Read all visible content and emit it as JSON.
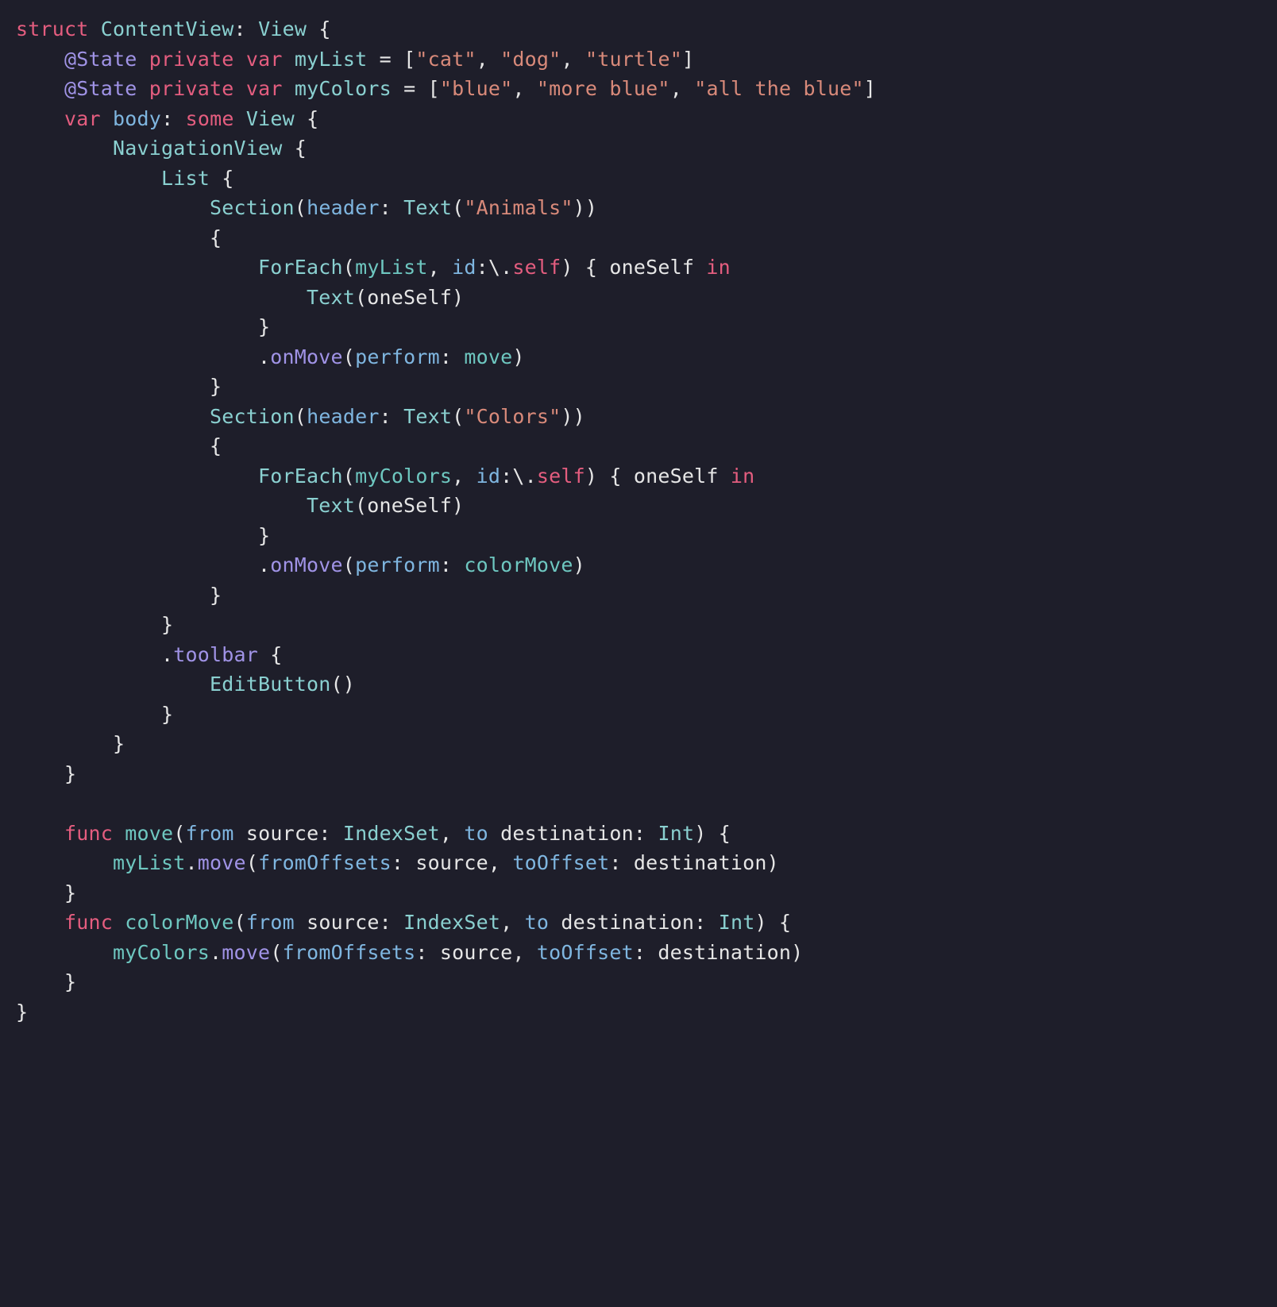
{
  "code": {
    "tokens": [
      [
        [
          "struct",
          "kw"
        ],
        [
          " ",
          ""
        ],
        [
          "ContentView",
          "type"
        ],
        [
          ": ",
          ""
        ],
        [
          "View",
          "type"
        ],
        [
          " {",
          ""
        ]
      ],
      [
        [
          "    ",
          ""
        ],
        [
          "@State",
          "prop"
        ],
        [
          " ",
          ""
        ],
        [
          "private",
          "kw"
        ],
        [
          " ",
          ""
        ],
        [
          "var",
          "kw"
        ],
        [
          " ",
          ""
        ],
        [
          "myList",
          "type"
        ],
        [
          " = [",
          ""
        ],
        [
          "\"cat\"",
          "str"
        ],
        [
          ", ",
          ""
        ],
        [
          "\"dog\"",
          "str"
        ],
        [
          ", ",
          ""
        ],
        [
          "\"turtle\"",
          "str"
        ],
        [
          "]",
          ""
        ]
      ],
      [
        [
          "    ",
          ""
        ],
        [
          "@State",
          "prop"
        ],
        [
          " ",
          ""
        ],
        [
          "private",
          "kw"
        ],
        [
          " ",
          ""
        ],
        [
          "var",
          "kw"
        ],
        [
          " ",
          ""
        ],
        [
          "myColors",
          "type"
        ],
        [
          " = [",
          ""
        ],
        [
          "\"blue\"",
          "str"
        ],
        [
          ", ",
          ""
        ],
        [
          "\"more blue\"",
          "str"
        ],
        [
          ", ",
          ""
        ],
        [
          "\"all the blue\"",
          "str"
        ],
        [
          "]",
          ""
        ]
      ],
      [
        [
          "    ",
          ""
        ],
        [
          "var",
          "kw"
        ],
        [
          " ",
          ""
        ],
        [
          "body",
          "param"
        ],
        [
          ": ",
          ""
        ],
        [
          "some",
          "kw"
        ],
        [
          " ",
          ""
        ],
        [
          "View",
          "type"
        ],
        [
          " {",
          ""
        ]
      ],
      [
        [
          "        ",
          ""
        ],
        [
          "NavigationView",
          "type"
        ],
        [
          " {",
          ""
        ]
      ],
      [
        [
          "            ",
          ""
        ],
        [
          "List",
          "type"
        ],
        [
          " {",
          ""
        ]
      ],
      [
        [
          "                ",
          ""
        ],
        [
          "Section",
          "type"
        ],
        [
          "(",
          ""
        ],
        [
          "header",
          "param"
        ],
        [
          ": ",
          ""
        ],
        [
          "Text",
          "type"
        ],
        [
          "(",
          ""
        ],
        [
          "\"Animals\"",
          "str"
        ],
        [
          "))",
          ""
        ]
      ],
      [
        [
          "                {",
          ""
        ]
      ],
      [
        [
          "                    ",
          ""
        ],
        [
          "ForEach",
          "type"
        ],
        [
          "(",
          ""
        ],
        [
          "myList",
          "teal"
        ],
        [
          ", ",
          ""
        ],
        [
          "id",
          "param"
        ],
        [
          ":\\.",
          ""
        ],
        [
          "self",
          "kw"
        ],
        [
          ") { oneSelf ",
          ""
        ],
        [
          "in",
          "kw"
        ]
      ],
      [
        [
          "                        ",
          ""
        ],
        [
          "Text",
          "type"
        ],
        [
          "(oneSelf)",
          ""
        ]
      ],
      [
        [
          "                    }",
          ""
        ]
      ],
      [
        [
          "                    .",
          ""
        ],
        [
          "onMove",
          "call"
        ],
        [
          "(",
          ""
        ],
        [
          "perform",
          "param"
        ],
        [
          ": ",
          ""
        ],
        [
          "move",
          "teal"
        ],
        [
          ")",
          ""
        ]
      ],
      [
        [
          "                }",
          ""
        ]
      ],
      [
        [
          "                ",
          ""
        ],
        [
          "Section",
          "type"
        ],
        [
          "(",
          ""
        ],
        [
          "header",
          "param"
        ],
        [
          ": ",
          ""
        ],
        [
          "Text",
          "type"
        ],
        [
          "(",
          ""
        ],
        [
          "\"Colors\"",
          "str"
        ],
        [
          "))",
          ""
        ]
      ],
      [
        [
          "                {",
          ""
        ]
      ],
      [
        [
          "                    ",
          ""
        ],
        [
          "ForEach",
          "type"
        ],
        [
          "(",
          ""
        ],
        [
          "myColors",
          "teal"
        ],
        [
          ", ",
          ""
        ],
        [
          "id",
          "param"
        ],
        [
          ":\\.",
          ""
        ],
        [
          "self",
          "kw"
        ],
        [
          ") { oneSelf ",
          ""
        ],
        [
          "in",
          "kw"
        ]
      ],
      [
        [
          "                        ",
          ""
        ],
        [
          "Text",
          "type"
        ],
        [
          "(oneSelf)",
          ""
        ]
      ],
      [
        [
          "                    }",
          ""
        ]
      ],
      [
        [
          "                    .",
          ""
        ],
        [
          "onMove",
          "call"
        ],
        [
          "(",
          ""
        ],
        [
          "perform",
          "param"
        ],
        [
          ": ",
          ""
        ],
        [
          "colorMove",
          "teal"
        ],
        [
          ")",
          ""
        ]
      ],
      [
        [
          "                }",
          ""
        ]
      ],
      [
        [
          "            }",
          ""
        ]
      ],
      [
        [
          "            .",
          ""
        ],
        [
          "toolbar",
          "call"
        ],
        [
          " {",
          ""
        ]
      ],
      [
        [
          "                ",
          ""
        ],
        [
          "EditButton",
          "type"
        ],
        [
          "()",
          ""
        ]
      ],
      [
        [
          "            }",
          ""
        ]
      ],
      [
        [
          "        }",
          ""
        ]
      ],
      [
        [
          "    }",
          ""
        ]
      ],
      [
        [
          "",
          ""
        ]
      ],
      [
        [
          "    ",
          ""
        ],
        [
          "func",
          "kw"
        ],
        [
          " ",
          ""
        ],
        [
          "move",
          "teal"
        ],
        [
          "(",
          ""
        ],
        [
          "from",
          "param"
        ],
        [
          " source: ",
          ""
        ],
        [
          "IndexSet",
          "type"
        ],
        [
          ", ",
          ""
        ],
        [
          "to",
          "param"
        ],
        [
          " destination: ",
          ""
        ],
        [
          "Int",
          "type"
        ],
        [
          ") {",
          ""
        ]
      ],
      [
        [
          "        ",
          ""
        ],
        [
          "myList",
          "teal"
        ],
        [
          ".",
          ""
        ],
        [
          "move",
          "call"
        ],
        [
          "(",
          ""
        ],
        [
          "fromOffsets",
          "param"
        ],
        [
          ": source, ",
          ""
        ],
        [
          "toOffset",
          "param"
        ],
        [
          ": destination)",
          ""
        ]
      ],
      [
        [
          "    }",
          ""
        ]
      ],
      [
        [
          "    ",
          ""
        ],
        [
          "func",
          "kw"
        ],
        [
          " ",
          ""
        ],
        [
          "colorMove",
          "teal"
        ],
        [
          "(",
          ""
        ],
        [
          "from",
          "param"
        ],
        [
          " source: ",
          ""
        ],
        [
          "IndexSet",
          "type"
        ],
        [
          ", ",
          ""
        ],
        [
          "to",
          "param"
        ],
        [
          " destination: ",
          ""
        ],
        [
          "Int",
          "type"
        ],
        [
          ") {",
          ""
        ]
      ],
      [
        [
          "        ",
          ""
        ],
        [
          "myColors",
          "teal"
        ],
        [
          ".",
          ""
        ],
        [
          "move",
          "call"
        ],
        [
          "(",
          ""
        ],
        [
          "fromOffsets",
          "param"
        ],
        [
          ": source, ",
          ""
        ],
        [
          "toOffset",
          "param"
        ],
        [
          ": destination)",
          ""
        ]
      ],
      [
        [
          "    }",
          ""
        ]
      ],
      [
        [
          "}",
          ""
        ]
      ]
    ]
  }
}
